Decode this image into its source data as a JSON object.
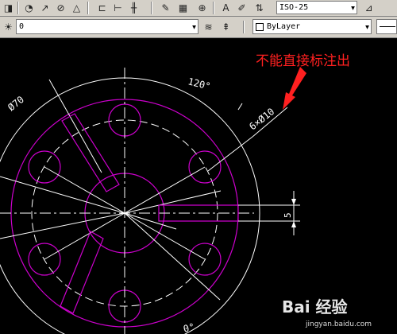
{
  "toolbar": {
    "dimstyle_value": "ISO-25"
  },
  "layers": {
    "layer_value": "0",
    "color_value": "ByLayer"
  },
  "drawing": {
    "angle_text": "120°",
    "diameter_text": "Ø70",
    "holes_text": "6×Ø10",
    "dim5_text": "5",
    "bottom_angle_text": "0°"
  },
  "annotation": {
    "text": "不能直接标注出",
    "color": "#ff2020"
  },
  "watermark": {
    "logo_text": "Bai 经验",
    "url_text": "jingyan.baidu.com"
  },
  "colors": {
    "geometry": "#cc00cc",
    "dimension": "#ffffff",
    "background": "#000000"
  }
}
